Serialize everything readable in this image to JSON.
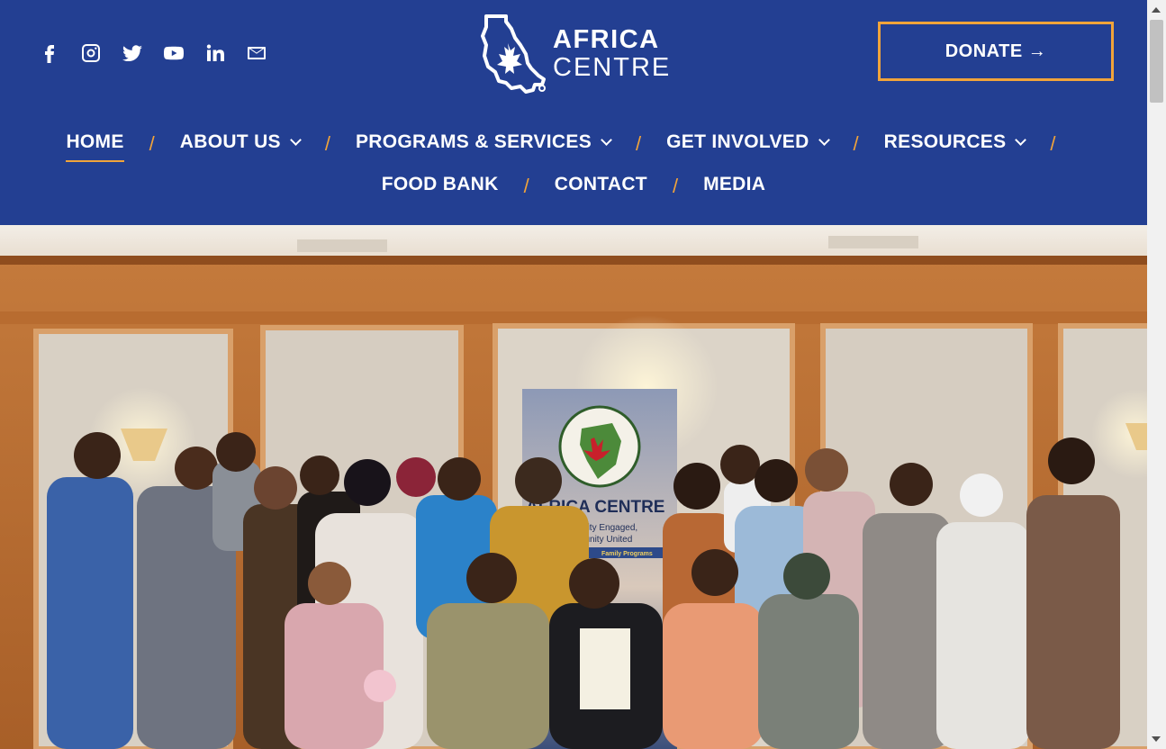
{
  "header": {
    "social_icons": [
      "facebook-icon",
      "instagram-icon",
      "twitter-icon",
      "youtube-icon",
      "linkedin-icon",
      "mail-icon"
    ],
    "logo": {
      "line1": "AFRICA",
      "line2": "CENTRE"
    },
    "donate_label": "DONATE →"
  },
  "nav": {
    "items": [
      {
        "label": "HOME",
        "active": true
      },
      {
        "label": "ABOUT US",
        "dropdown": true
      },
      {
        "label": "PROGRAMS & SERVICES",
        "dropdown": true
      },
      {
        "label": "GET INVOLVED",
        "dropdown": true
      },
      {
        "label": "RESOURCES",
        "dropdown": true
      },
      {
        "label": "FOOD BANK"
      },
      {
        "label": "CONTACT"
      },
      {
        "label": "MEDIA"
      }
    ],
    "separator": "/"
  },
  "hero": {
    "banner": {
      "title": "AFRICA CENTRE",
      "tagline1": "Community Engaged,",
      "tagline2": "Community United",
      "band": "Family Programs"
    }
  },
  "colors": {
    "brand_blue": "#233f92",
    "accent_orange": "#f1a43a"
  }
}
